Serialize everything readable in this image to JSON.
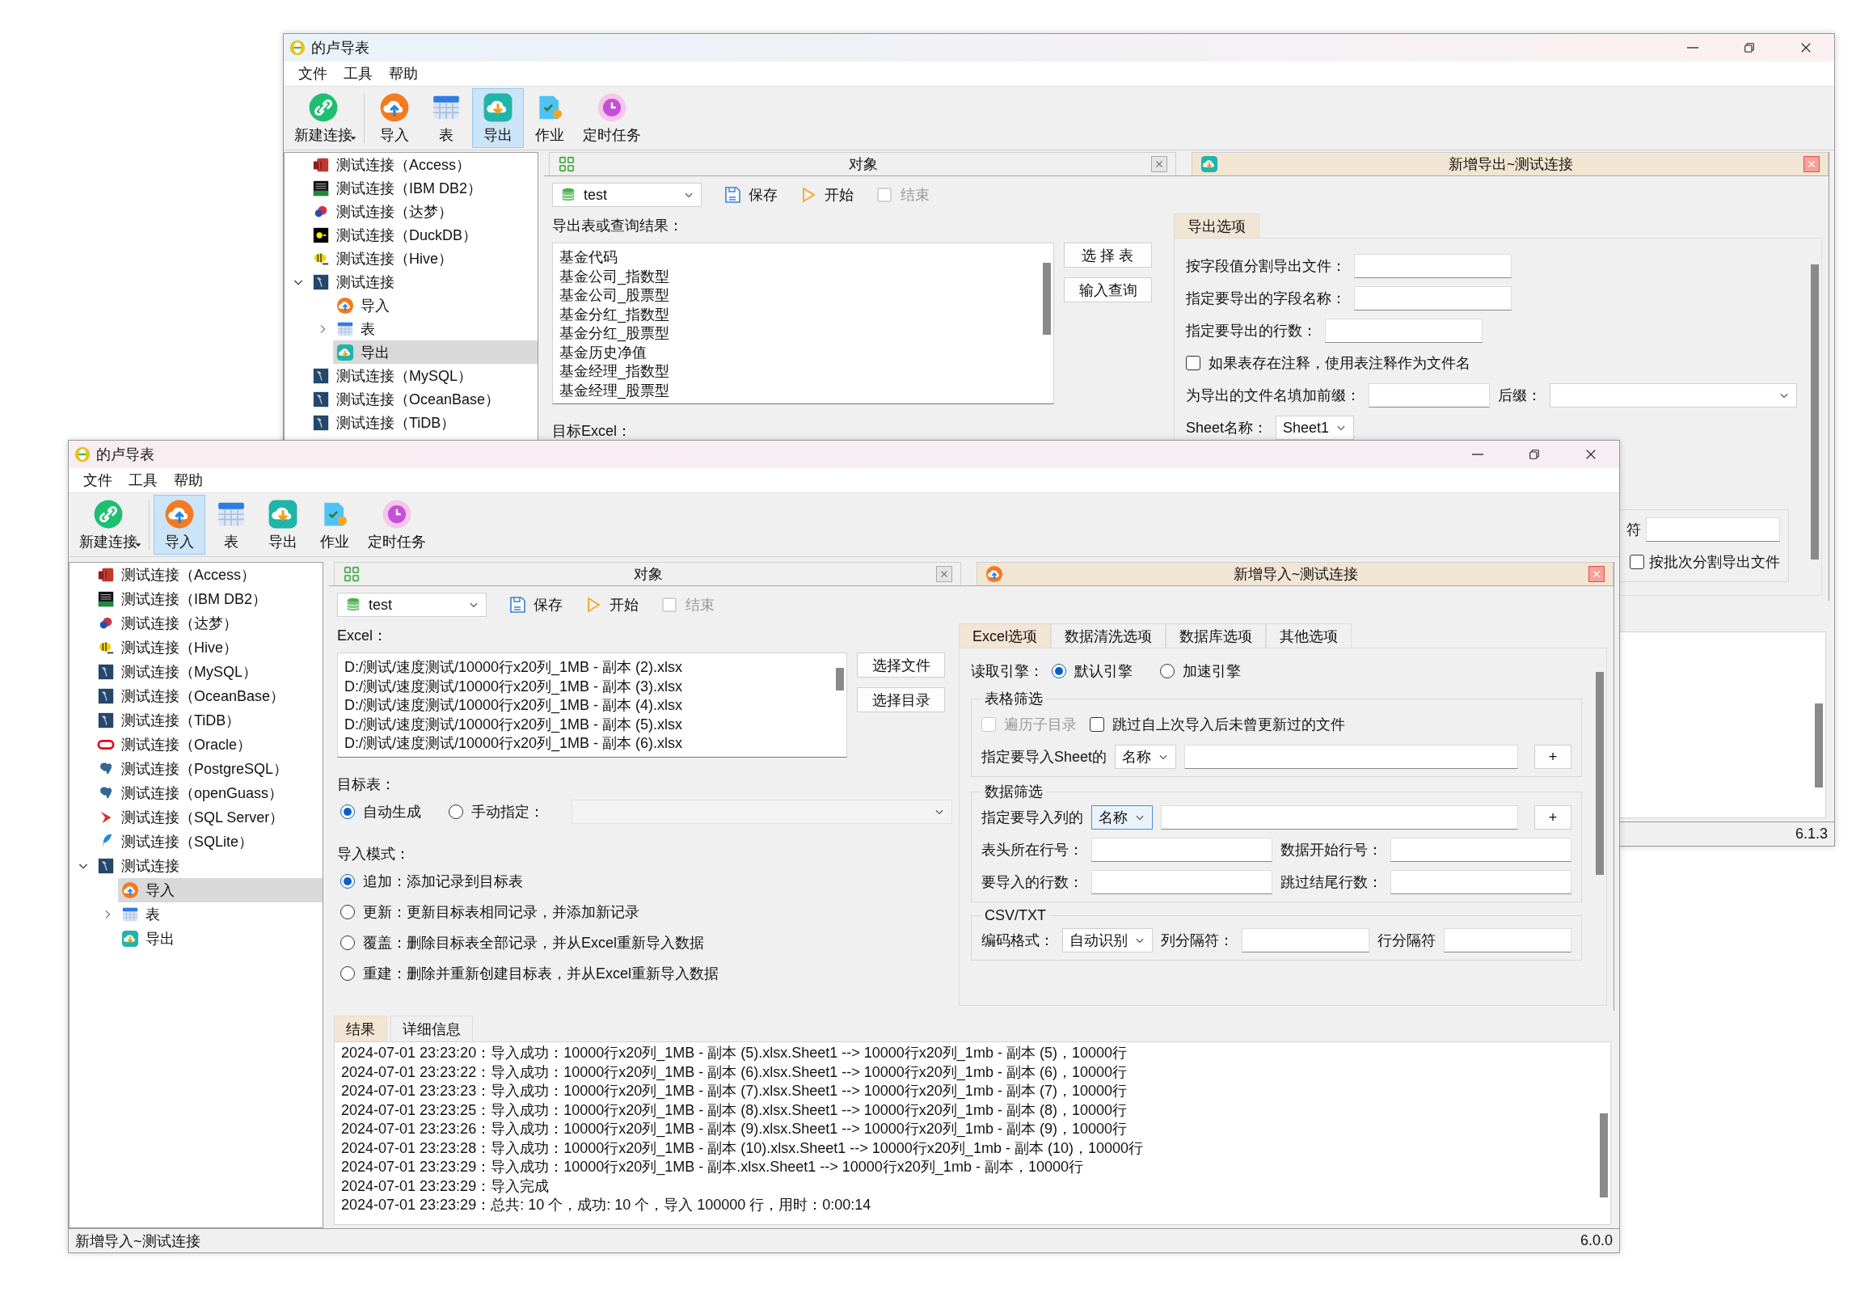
{
  "windows": [
    {
      "title": "的卢导表",
      "menu": [
        "文件",
        "工具",
        "帮助"
      ],
      "toolbar": [
        {
          "kind": "connect",
          "label": "新建连接",
          "selected": false,
          "dropdown": true
        },
        {
          "kind": "import",
          "label": "导入",
          "selected": false,
          "dropdown": false
        },
        {
          "kind": "table",
          "label": "表",
          "selected": false,
          "dropdown": false
        },
        {
          "kind": "export",
          "label": "导出",
          "selected": true,
          "dropdown": false
        },
        {
          "kind": "job",
          "label": "作业",
          "selected": false,
          "dropdown": false
        },
        {
          "kind": "schedule",
          "label": "定时任务",
          "selected": false,
          "dropdown": false
        }
      ],
      "tree": [
        {
          "kind": "access",
          "label": "测试连接（Access）",
          "selected": false
        },
        {
          "kind": "db2",
          "label": "测试连接（IBM DB2）",
          "selected": false
        },
        {
          "kind": "dameng",
          "label": "测试连接（达梦）",
          "selected": false
        },
        {
          "kind": "duckdb",
          "label": "测试连接（DuckDB）",
          "selected": false
        },
        {
          "kind": "hive",
          "label": "测试连接（Hive）",
          "selected": false
        },
        {
          "kind": "mysql",
          "label": "测试连接",
          "selected": false,
          "expanded": true,
          "children": [
            {
              "kind": "import",
              "label": "导入",
              "selected": false
            },
            {
              "kind": "table",
              "label": "表",
              "selected": false,
              "expanded": false
            },
            {
              "kind": "export",
              "label": "导出",
              "selected": true
            }
          ]
        },
        {
          "kind": "mysql",
          "label": "测试连接（MySQL）",
          "selected": false
        },
        {
          "kind": "mysql",
          "label": "测试连接（OceanBase）",
          "selected": false
        },
        {
          "kind": "mysql",
          "label": "测试连接（TiDB）",
          "selected": false
        }
      ],
      "doc_tabs": [
        {
          "kind": "objects",
          "label": "对象",
          "selected": false
        },
        {
          "kind": "export",
          "label": "新增导出~测试连接",
          "selected": true
        }
      ],
      "doc_toolbar": {
        "database": "test",
        "actions": [
          {
            "kind": "save",
            "label": "保存",
            "disabled": false
          },
          {
            "kind": "start",
            "label": "开始",
            "disabled": false
          },
          {
            "kind": "stop",
            "label": "结束",
            "disabled": true
          }
        ]
      },
      "form": {
        "kind": "export",
        "list_label": "导出表或查询结果：",
        "list": [
          "基金代码",
          "基金公司_指数型",
          "基金公司_股票型",
          "基金分红_指数型",
          "基金分红_股票型",
          "基金历史净值",
          "基金经理_指数型",
          "基金经理_股票型"
        ],
        "buttons": [
          "选 择 表",
          "输入查询"
        ],
        "target_label": "目标Excel：",
        "option_tabs": [
          {
            "label": "导出选项",
            "selected": true
          }
        ],
        "rows": [
          [
            {
              "kind": "label",
              "text": "按字段值分割导出文件："
            },
            {
              "kind": "input"
            }
          ],
          [
            {
              "kind": "label",
              "text": "指定要导出的字段名称："
            },
            {
              "kind": "input"
            }
          ],
          [
            {
              "kind": "label",
              "text": "指定要导出的行数："
            },
            {
              "kind": "input"
            }
          ],
          [
            {
              "kind": "checkbox",
              "label": "如果表存在注释，使用表注释作为文件名",
              "checked": false,
              "disabled": false
            }
          ],
          [
            {
              "kind": "label",
              "text": "为导出的文件名填加前缀："
            },
            {
              "kind": "input"
            },
            {
              "kind": "label",
              "text": "后缀："
            },
            {
              "kind": "combo",
              "focused": false
            }
          ],
          [
            {
              "kind": "label",
              "text": "Sheet名称："
            },
            {
              "kind": "combo",
              "value": "Sheet1",
              "focused": false
            }
          ]
        ],
        "bottom_rows": [
          [
            {
              "kind": "label",
              "text": "符"
            },
            {
              "kind": "input"
            }
          ],
          [
            {
              "kind": "checkbox",
              "label": "按批次分割导出文件",
              "checked": false,
              "disabled": false
            }
          ]
        ]
      },
      "status": {
        "version": "6.1.3"
      }
    },
    {
      "title": "的卢导表",
      "menu": [
        "文件",
        "工具",
        "帮助"
      ],
      "toolbar": [
        {
          "kind": "connect",
          "label": "新建连接",
          "selected": false,
          "dropdown": true
        },
        {
          "kind": "import",
          "label": "导入",
          "selected": true,
          "dropdown": false
        },
        {
          "kind": "table",
          "label": "表",
          "selected": false,
          "dropdown": false
        },
        {
          "kind": "export",
          "label": "导出",
          "selected": false,
          "dropdown": false
        },
        {
          "kind": "job",
          "label": "作业",
          "selected": false,
          "dropdown": false
        },
        {
          "kind": "schedule",
          "label": "定时任务",
          "selected": false,
          "dropdown": false
        }
      ],
      "tree": [
        {
          "kind": "access",
          "label": "测试连接（Access）",
          "selected": false
        },
        {
          "kind": "db2",
          "label": "测试连接（IBM DB2）",
          "selected": false
        },
        {
          "kind": "dameng",
          "label": "测试连接（达梦）",
          "selected": false
        },
        {
          "kind": "hive",
          "label": "测试连接（Hive）",
          "selected": false
        },
        {
          "kind": "mysql",
          "label": "测试连接（MySQL）",
          "selected": false
        },
        {
          "kind": "mysql",
          "label": "测试连接（OceanBase）",
          "selected": false
        },
        {
          "kind": "mysql",
          "label": "测试连接（TiDB）",
          "selected": false
        },
        {
          "kind": "oracle",
          "label": "测试连接（Oracle）",
          "selected": false
        },
        {
          "kind": "postgres",
          "label": "测试连接（PostgreSQL）",
          "selected": false
        },
        {
          "kind": "postgres",
          "label": "测试连接（openGuass）",
          "selected": false
        },
        {
          "kind": "sqlserver",
          "label": "测试连接（SQL Server）",
          "selected": false
        },
        {
          "kind": "sqlite",
          "label": "测试连接（SQLite）",
          "selected": false
        },
        {
          "kind": "mysql",
          "label": "测试连接",
          "selected": false,
          "expanded": true,
          "children": [
            {
              "kind": "import",
              "label": "导入",
              "selected": true
            },
            {
              "kind": "table",
              "label": "表",
              "selected": false,
              "expanded": false
            },
            {
              "kind": "export",
              "label": "导出",
              "selected": false
            }
          ]
        }
      ],
      "doc_tabs": [
        {
          "kind": "objects",
          "label": "对象",
          "selected": false
        },
        {
          "kind": "import",
          "label": "新增导入~测试连接",
          "selected": true
        }
      ],
      "doc_toolbar": {
        "database": "test",
        "actions": [
          {
            "kind": "save",
            "label": "保存",
            "disabled": false
          },
          {
            "kind": "start",
            "label": "开始",
            "disabled": false
          },
          {
            "kind": "stop",
            "label": "结束",
            "disabled": true
          }
        ]
      },
      "form": {
        "kind": "import",
        "file_label": "Excel：",
        "files": [
          "D:/测试/速度测试/10000行x20列_1MB - 副本 (2).xlsx",
          "D:/测试/速度测试/10000行x20列_1MB - 副本 (3).xlsx",
          "D:/测试/速度测试/10000行x20列_1MB - 副本 (4).xlsx",
          "D:/测试/速度测试/10000行x20列_1MB - 副本 (5).xlsx",
          "D:/测试/速度测试/10000行x20列_1MB - 副本 (6).xlsx"
        ],
        "buttons": [
          "选择文件",
          "选择目录"
        ],
        "target_label": "目标表：",
        "target_options": [
          {
            "label": "自动生成",
            "selected": true
          },
          {
            "label": "手动指定：",
            "selected": false
          }
        ],
        "target_table": {
          "disabled": true
        },
        "mode_label": "导入模式：",
        "modes": [
          {
            "label": "追加：添加记录到目标表",
            "selected": true
          },
          {
            "label": "更新：更新目标表相同记录，并添加新记录",
            "selected": false
          },
          {
            "label": "覆盖：删除目标表全部记录，并从Excel重新导入数据",
            "selected": false
          },
          {
            "label": "重建：删除并重新创建目标表，并从Excel重新导入数据",
            "selected": false
          }
        ],
        "option_tabs": [
          {
            "label": "Excel选项",
            "selected": true
          },
          {
            "label": "数据清洗选项",
            "selected": false
          },
          {
            "label": "数据库选项",
            "selected": false
          },
          {
            "label": "其他选项",
            "selected": false
          }
        ],
        "engine": {
          "label": "读取引擎：",
          "options": [
            {
              "label": "默认引擎",
              "selected": true
            },
            {
              "label": "加速引擎",
              "selected": false
            }
          ]
        },
        "groups": [
          {
            "title": "表格筛选",
            "rows": [
              [
                {
                  "kind": "checkbox",
                  "label": "遍历子目录",
                  "checked": false,
                  "disabled": true
                },
                {
                  "kind": "checkbox",
                  "label": "跳过自上次导入后未曾更新过的文件",
                  "checked": false,
                  "disabled": false
                }
              ],
              [
                {
                  "kind": "label",
                  "text": "指定要导入Sheet的"
                },
                {
                  "kind": "combo",
                  "value": "名称",
                  "focused": false
                },
                {
                  "kind": "input"
                },
                {
                  "kind": "button",
                  "label": "+"
                }
              ]
            ]
          },
          {
            "title": "数据筛选",
            "rows": [
              [
                {
                  "kind": "label",
                  "text": "指定要导入列的"
                },
                {
                  "kind": "combo",
                  "value": "名称",
                  "focused": true
                },
                {
                  "kind": "input"
                },
                {
                  "kind": "button",
                  "label": "+"
                }
              ],
              [
                {
                  "kind": "label",
                  "text": "表头所在行号："
                },
                {
                  "kind": "input"
                },
                {
                  "kind": "label",
                  "text": "数据开始行号："
                },
                {
                  "kind": "input"
                }
              ],
              [
                {
                  "kind": "label",
                  "text": "要导入的行数："
                },
                {
                  "kind": "input"
                },
                {
                  "kind": "label",
                  "text": "跳过结尾行数："
                },
                {
                  "kind": "input"
                }
              ]
            ]
          },
          {
            "title": "CSV/TXT",
            "rows": [
              [
                {
                  "kind": "label",
                  "text": "编码格式："
                },
                {
                  "kind": "combo",
                  "value": "自动识别",
                  "focused": false
                },
                {
                  "kind": "label",
                  "text": "列分隔符："
                },
                {
                  "kind": "input"
                },
                {
                  "kind": "label",
                  "text": "行分隔符"
                },
                {
                  "kind": "input"
                }
              ]
            ]
          }
        ]
      },
      "log": {
        "tabs": [
          {
            "label": "结果",
            "selected": true
          },
          {
            "label": "详细信息",
            "selected": false
          }
        ],
        "lines": [
          "2024-07-01 23:23:20：导入成功：10000行x20列_1MB - 副本 (5).xlsx.Sheet1 --> 10000行x20列_1mb - 副本 (5)，10000行",
          "2024-07-01 23:23:22：导入成功：10000行x20列_1MB - 副本 (6).xlsx.Sheet1 --> 10000行x20列_1mb - 副本 (6)，10000行",
          "2024-07-01 23:23:23：导入成功：10000行x20列_1MB - 副本 (7).xlsx.Sheet1 --> 10000行x20列_1mb - 副本 (7)，10000行",
          "2024-07-01 23:23:25：导入成功：10000行x20列_1MB - 副本 (8).xlsx.Sheet1 --> 10000行x20列_1mb - 副本 (8)，10000行",
          "2024-07-01 23:23:26：导入成功：10000行x20列_1MB - 副本 (9).xlsx.Sheet1 --> 10000行x20列_1mb - 副本 (9)，10000行",
          "2024-07-01 23:23:28：导入成功：10000行x20列_1MB - 副本 (10).xlsx.Sheet1 --> 10000行x20列_1mb - 副本 (10)，10000行",
          "2024-07-01 23:23:29：导入成功：10000行x20列_1MB - 副本.xlsx.Sheet1 --> 10000行x20列_1mb - 副本，10000行",
          "2024-07-01 23:23:29：导入完成",
          "2024-07-01 23:23:29：总共: 10 个，成功: 10 个，导入 100000 行，用时：0:00:14"
        ]
      },
      "status": {
        "text": "新增导入~测试连接",
        "version": "6.0.0"
      }
    }
  ]
}
